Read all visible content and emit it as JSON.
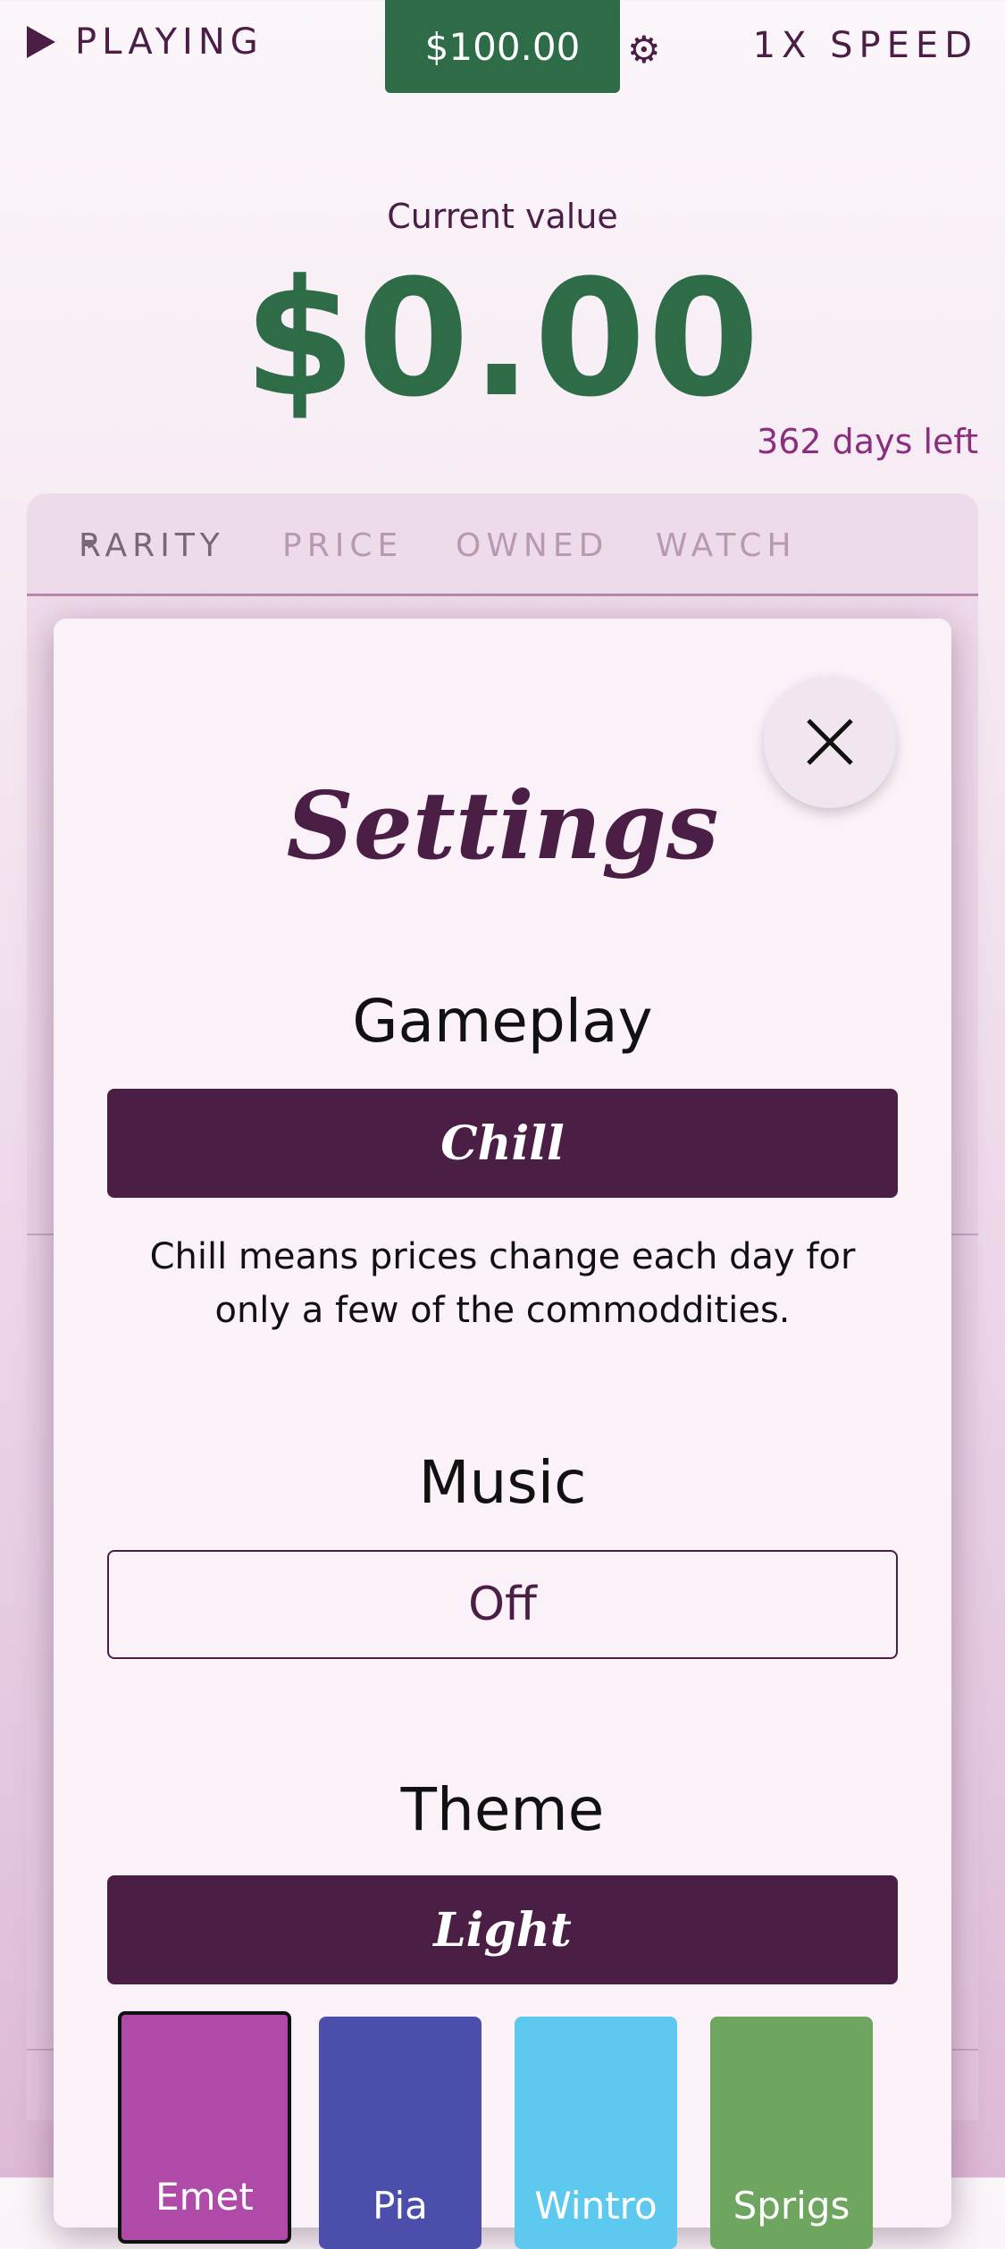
{
  "topbar": {
    "playing_label": "PLAYING",
    "balance": "$100.00",
    "gear_icon": "gear-icon",
    "speed_label": "1X SPEED"
  },
  "summary": {
    "current_value_label": "Current value",
    "current_value": "$0.00",
    "days_left": "362 days left"
  },
  "tabs": [
    {
      "label": "RARITY",
      "active": true
    },
    {
      "label": "PRICE",
      "active": false
    },
    {
      "label": "OWNED",
      "active": false
    },
    {
      "label": "WATCH",
      "active": false
    }
  ],
  "settings": {
    "title": "Settings",
    "gameplay": {
      "title": "Gameplay",
      "value": "Chill",
      "description": "Chill means prices change each day for only a few of the commoddities."
    },
    "music": {
      "title": "Music",
      "value": "Off"
    },
    "theme": {
      "title": "Theme",
      "value": "Light",
      "options": [
        {
          "label": "Emet",
          "color": "#b04aa8",
          "selected": true
        },
        {
          "label": "Pia",
          "color": "#4b4fab",
          "selected": false
        },
        {
          "label": "Wintro",
          "color": "#5ec9ef",
          "selected": false
        },
        {
          "label": "Sprigs",
          "color": "#6ea55f",
          "selected": false
        }
      ]
    }
  },
  "colors": {
    "brand_purple": "#4a1e45",
    "brand_green": "#2e6b47",
    "accent_magenta": "#8b2e7e"
  }
}
